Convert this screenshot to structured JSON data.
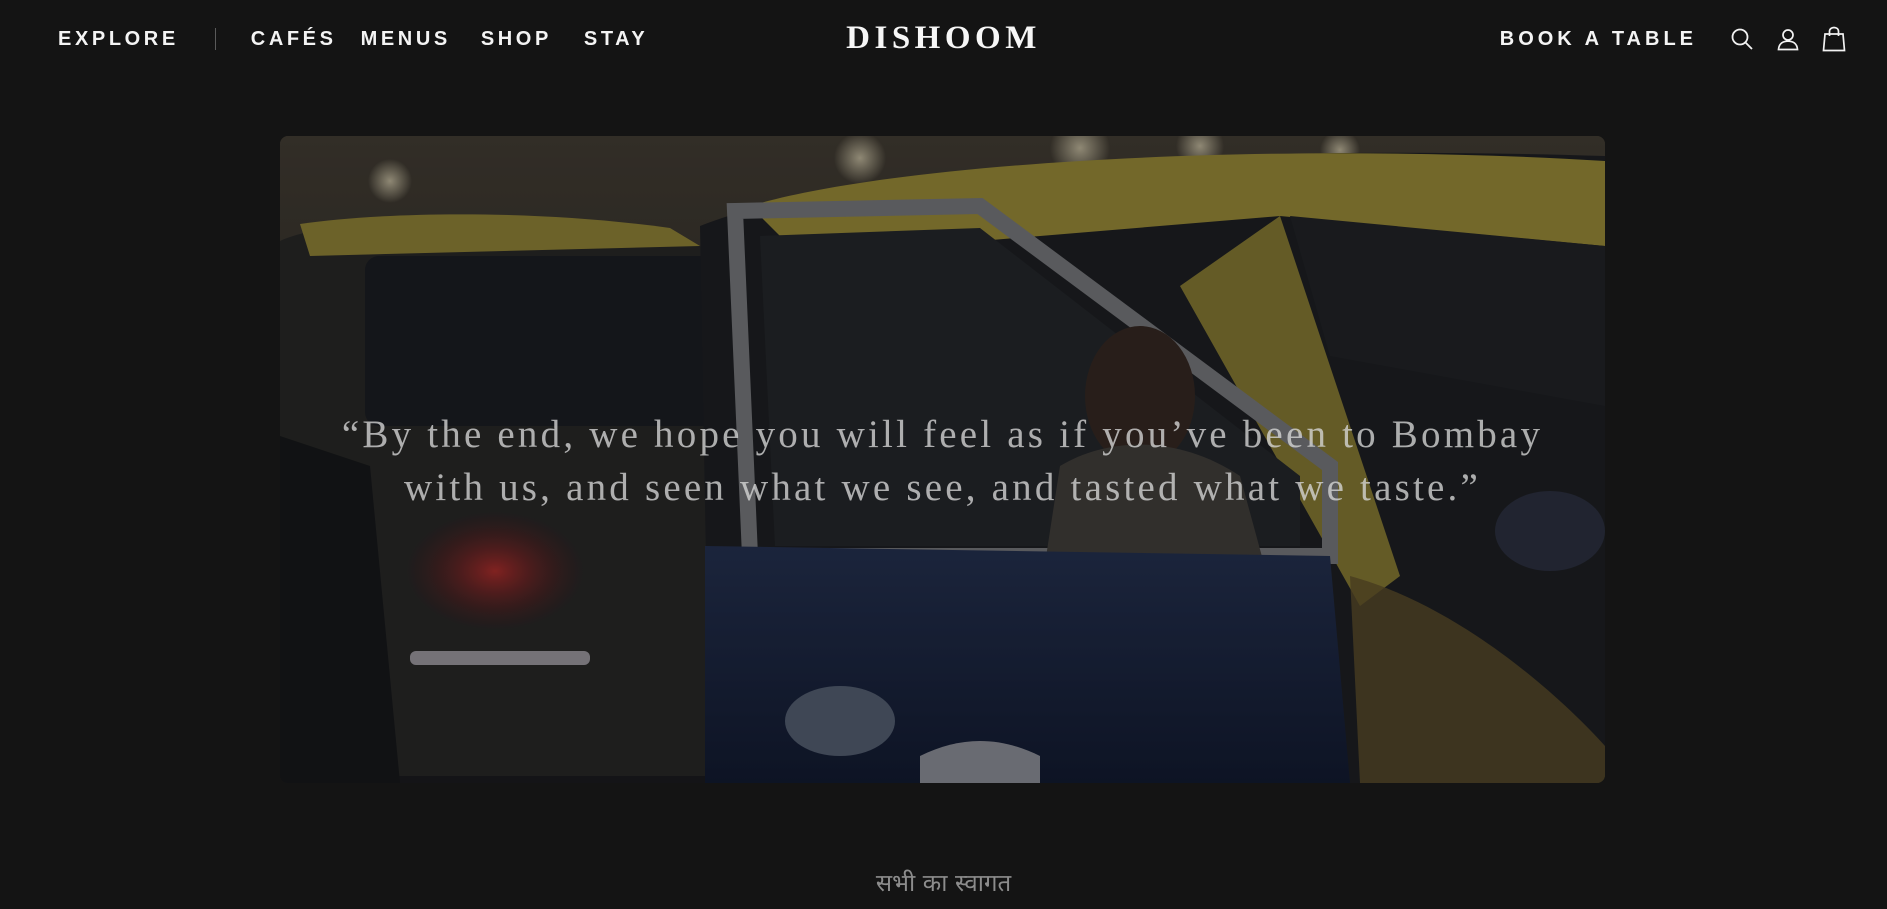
{
  "nav": {
    "explore": "EXPLORE",
    "items": [
      "CAFÉS",
      "MENUS",
      "SHOP",
      "STAY"
    ]
  },
  "logo": "DISHOOM",
  "actions": {
    "book": "BOOK A TABLE",
    "icons": [
      "search-icon",
      "account-icon",
      "bag-icon"
    ]
  },
  "hero": {
    "quote_line1": "“By the end, we hope you will feel as if you’ve been to Bombay",
    "quote_line2": "with us, and seen what we see, and tasted what we taste.”"
  },
  "welcome": "सभी का स्वागत",
  "colors": {
    "background": "#141414",
    "text": "#f4f4f4",
    "taxi_yellow": "#b8a33a",
    "taxi_blue": "#1c2a4a"
  }
}
